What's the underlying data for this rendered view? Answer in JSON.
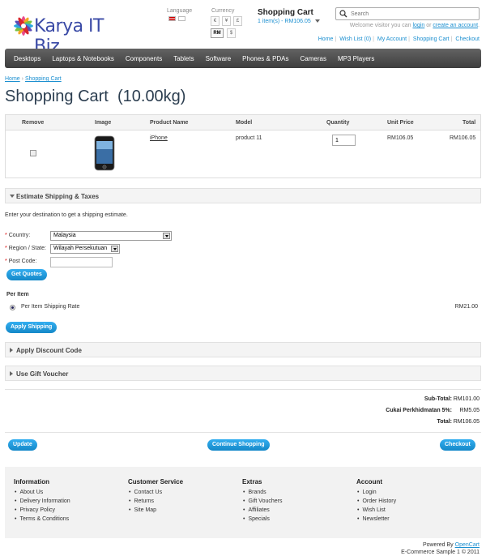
{
  "header": {
    "logo_text": "Karya IT Biz",
    "language_label": "Language",
    "currency_label": "Currency",
    "currencies": [
      "€",
      "¥",
      "£",
      "RM",
      "$"
    ],
    "selected_currency": "RM",
    "cart_title": "Shopping Cart",
    "cart_summary": "1 item(s) - RM106.05",
    "search_placeholder": "Search",
    "welcome_prefix": "Welcome visitor you can",
    "welcome_login": "login",
    "welcome_or": "or",
    "welcome_create": "create an account",
    "links": [
      "Home",
      "Wish List (0)",
      "My Account",
      "Shopping Cart",
      "Checkout"
    ]
  },
  "menu": [
    "Desktops",
    "Laptops & Notebooks",
    "Components",
    "Tablets",
    "Software",
    "Phones & PDAs",
    "Cameras",
    "MP3 Players"
  ],
  "breadcrumb": [
    "Home",
    "Shopping Cart"
  ],
  "page_title": "Shopping Cart  (10.00kg)",
  "cart_table": {
    "headers": [
      "Remove",
      "Image",
      "Product Name",
      "Model",
      "Quantity",
      "Unit Price",
      "Total"
    ],
    "rows": [
      {
        "name": "iPhone",
        "model": "product 11",
        "quantity": "1",
        "unit_price": "RM106.05",
        "total": "RM106.05"
      }
    ]
  },
  "shipping": {
    "title": "Estimate Shipping & Taxes",
    "intro": "Enter your destination to get a shipping estimate.",
    "country_label": "Country:",
    "country_value": "Malaysia",
    "region_label": "Region / State:",
    "region_value": "Wilayah Persekutuan",
    "postcode_label": "Post Code:",
    "quote_button": "Get Quotes",
    "method_heading": "Per Item",
    "method_label": "Per Item Shipping Rate",
    "method_price": "RM21.00",
    "apply_button": "Apply Shipping"
  },
  "discount_title": "Apply Discount Code",
  "voucher_title": "Use Gift Voucher",
  "totals": [
    {
      "label": "Sub-Total:",
      "value": "RM101.00"
    },
    {
      "label": "Cukai Perkhidmatan 5%:",
      "value": "RM5.05"
    },
    {
      "label": "Total:",
      "value": "RM106.05"
    }
  ],
  "buttons": {
    "update": "Update",
    "continue": "Continue Shopping",
    "checkout": "Checkout"
  },
  "footer": {
    "columns": [
      {
        "title": "Information",
        "items": [
          "About Us",
          "Delivery Information",
          "Privacy Policy",
          "Terms & Conditions"
        ]
      },
      {
        "title": "Customer Service",
        "items": [
          "Contact Us",
          "Returns",
          "Site Map"
        ]
      },
      {
        "title": "Extras",
        "items": [
          "Brands",
          "Gift Vouchers",
          "Affiliates",
          "Specials"
        ]
      },
      {
        "title": "Account",
        "items": [
          "Login",
          "Order History",
          "Wish List",
          "Newsletter"
        ]
      }
    ],
    "powered_prefix": "Powered By",
    "powered_link": "OpenCart",
    "copyright": "E-Commerce Sample 1 © 2011"
  },
  "colors": {
    "link": "#1b8fd0",
    "menu_bg": "#4a4a4a",
    "button": "#1b95d8",
    "title": "#2c3e50"
  }
}
